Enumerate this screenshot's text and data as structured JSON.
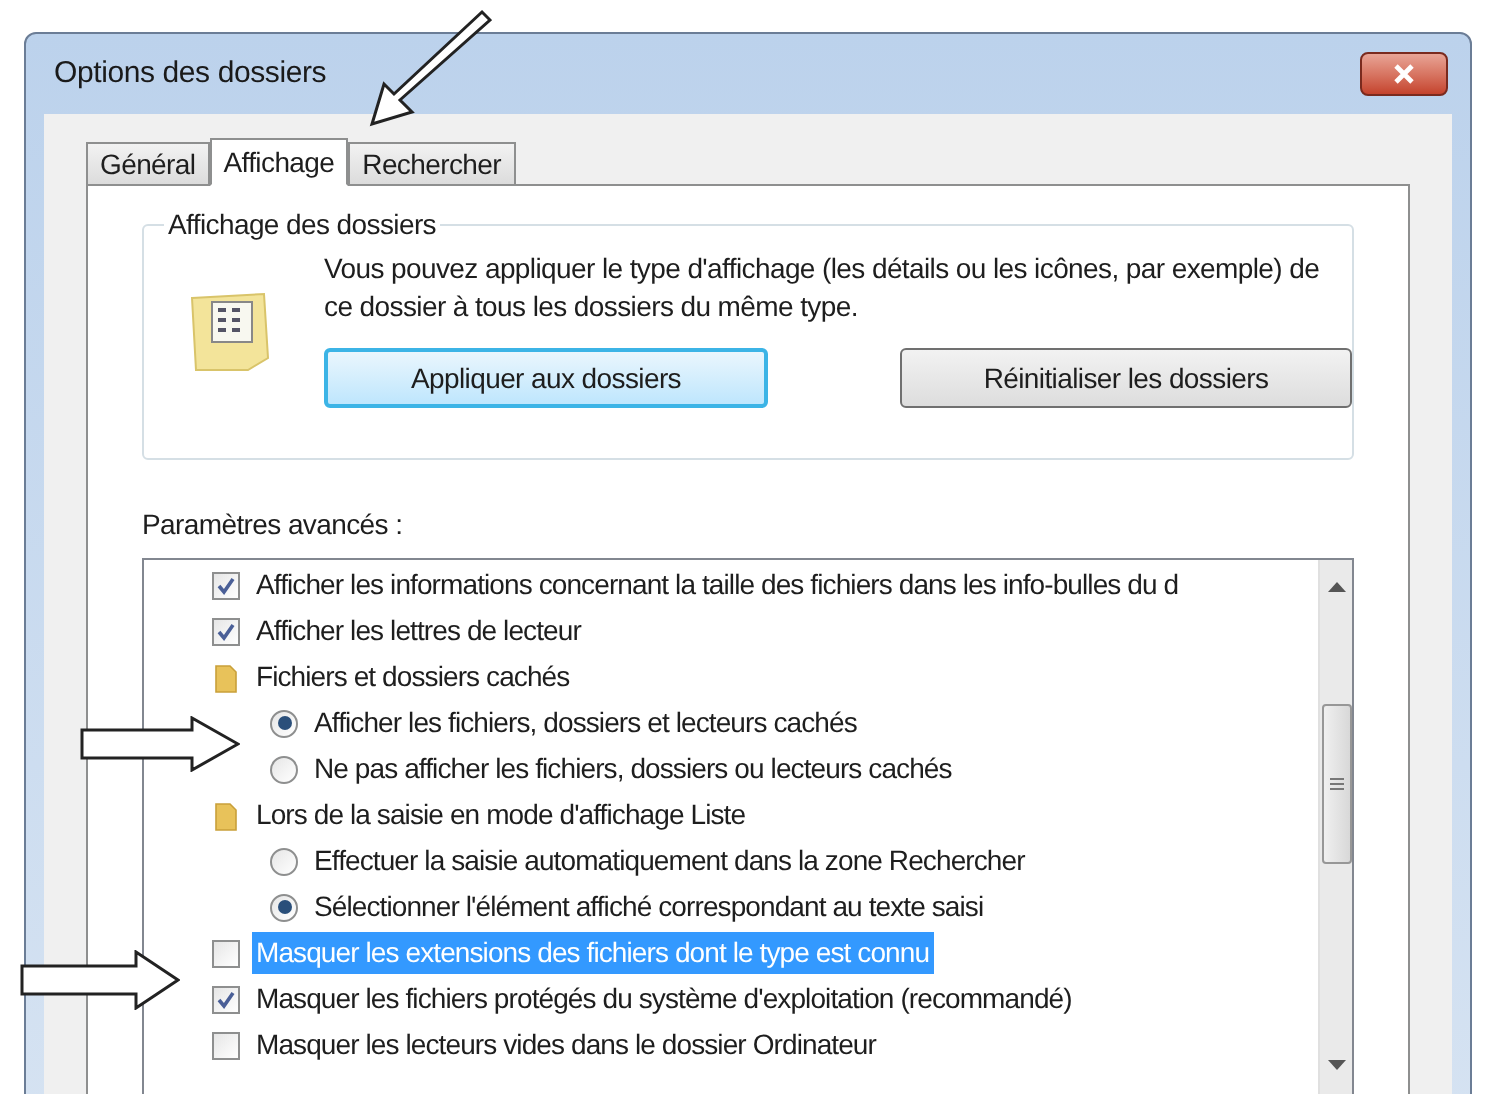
{
  "window": {
    "title": "Options des dossiers"
  },
  "tabs": [
    {
      "label": "Général",
      "selected": false
    },
    {
      "label": "Affichage",
      "selected": true
    },
    {
      "label": "Rechercher",
      "selected": false
    }
  ],
  "folder_views": {
    "title": "Affichage des dossiers",
    "description": "Vous pouvez appliquer le type d'affichage (les détails ou les icônes, par exemple) de ce dossier à tous les dossiers du même type.",
    "buttons": [
      {
        "label": "Appliquer aux dossiers",
        "focused": true
      },
      {
        "label": "Réinitialiser les dossiers",
        "focused": false
      }
    ]
  },
  "advanced": {
    "title": "Paramètres avancés :",
    "items": [
      {
        "kind": "checkbox",
        "label": "Afficher les informations concernant la taille des fichiers dans les info-bulles du d",
        "checked": true,
        "selected": false
      },
      {
        "kind": "checkbox",
        "label": "Afficher les lettres de lecteur",
        "checked": true,
        "selected": false
      },
      {
        "kind": "folder",
        "label": "Fichiers et dossiers cachés",
        "children": [
          {
            "kind": "radio",
            "label": "Afficher les fichiers, dossiers et lecteurs cachés",
            "checked": true,
            "selected": false
          },
          {
            "kind": "radio",
            "label": "Ne pas afficher les fichiers, dossiers ou lecteurs cachés",
            "checked": false,
            "selected": false
          }
        ]
      },
      {
        "kind": "folder",
        "label": "Lors de la saisie en mode d'affichage Liste",
        "children": [
          {
            "kind": "radio",
            "label": "Effectuer la saisie automatiquement dans la zone Rechercher",
            "checked": false,
            "selected": false
          },
          {
            "kind": "radio",
            "label": "Sélectionner l'élément affiché correspondant au texte saisi",
            "checked": true,
            "selected": false
          }
        ]
      },
      {
        "kind": "checkbox",
        "label": "Masquer les extensions des fichiers dont le type est connu",
        "checked": false,
        "selected": true
      },
      {
        "kind": "checkbox",
        "label": "Masquer les fichiers protégés du système d'exploitation (recommandé)",
        "checked": true,
        "selected": false
      },
      {
        "kind": "checkbox",
        "label": "Masquer les lecteurs vides dans le dossier Ordinateur",
        "checked": false,
        "selected": false
      }
    ]
  }
}
